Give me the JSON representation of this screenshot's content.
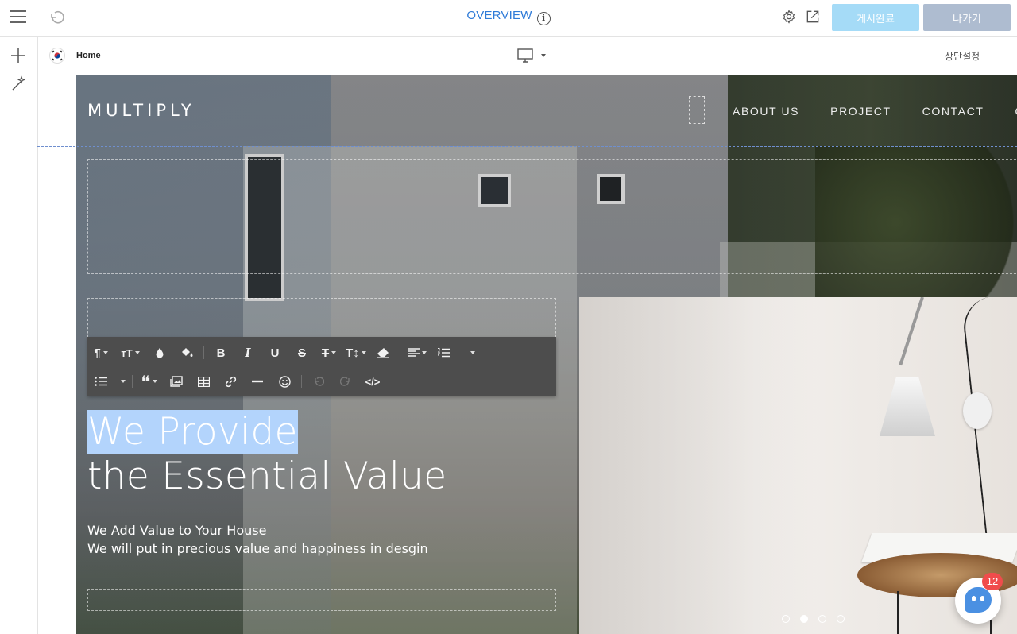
{
  "topbar": {
    "title": "OVERVIEW",
    "info_icon": "i",
    "publish_label": "게시완료",
    "exit_label": "나가기"
  },
  "pagebar": {
    "page_name": "Home",
    "header_settings_label": "상단설정"
  },
  "site": {
    "brand": "MULTIPLY",
    "nav": [
      "ABOUT US",
      "PROJECT",
      "CONTACT",
      "Q"
    ],
    "hero_title_selected": "We Provide",
    "hero_title_line2": "the Essential Value",
    "hero_sub_line1": "We Add Value to Your House",
    "hero_sub_line2": "We will put in precious value and happiness in desgin",
    "slider_dots": 4,
    "slider_active_index": 1
  },
  "chat": {
    "badge_count": "12"
  },
  "colors": {
    "accent": "#2f7bd8",
    "publish_bg": "#a5dbf7",
    "exit_bg": "#aebcd0",
    "toolbar_bg": "#4d4d4d",
    "selection": "#b3d4fc",
    "badge": "#f04c4c"
  },
  "icons": {
    "topbar": [
      "menu-icon",
      "undo-icon",
      "info-icon",
      "gear-icon",
      "external-link-icon"
    ],
    "rail": [
      "plus-icon",
      "magic-wand-icon"
    ],
    "toolbar": [
      "paragraph-icon",
      "font-size-icon",
      "text-color-icon",
      "background-color-icon",
      "bold-icon",
      "italic-icon",
      "underline-icon",
      "strikethrough-icon",
      "text-transform-icon",
      "line-height-icon",
      "eraser-icon",
      "align-icon",
      "ordered-list-icon",
      "unordered-list-icon",
      "quote-icon",
      "image-icon",
      "table-icon",
      "link-icon",
      "horizontal-rule-icon",
      "emoji-icon",
      "undo-icon",
      "redo-icon",
      "code-view-icon"
    ]
  }
}
